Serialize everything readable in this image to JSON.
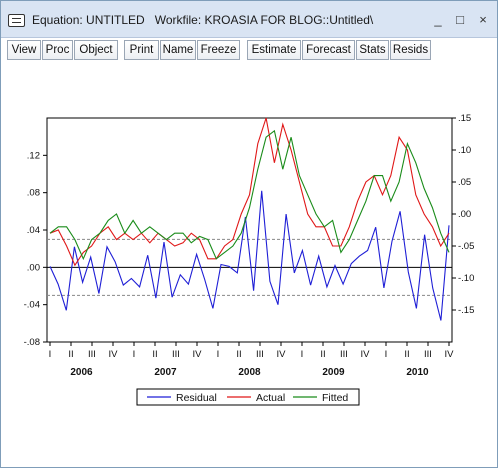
{
  "window": {
    "title": "Equation: UNTITLED   Workfile: KROASIA FOR BLOG::Untitled\\",
    "controls": {
      "minimize": "_",
      "maximize": "□",
      "close": "×"
    }
  },
  "toolbar": {
    "buttons": [
      "View",
      "Proc",
      "Object",
      "Print",
      "Name",
      "Freeze",
      "Estimate",
      "Forecast",
      "Stats",
      "Resids"
    ]
  },
  "chart_data": {
    "type": "line",
    "x": [
      "2006Q1",
      "2006Q2",
      "2006Q3",
      "2006Q4",
      "2007Q1",
      "2007Q2",
      "2007Q3",
      "2007Q4",
      "2008Q1",
      "2008Q2",
      "2008Q3",
      "2008Q4",
      "2009Q1",
      "2009Q2",
      "2009Q3",
      "2009Q4",
      "2010Q1",
      "2010Q2",
      "2010Q3",
      "2010Q4"
    ],
    "x_tick_labels": [
      "I",
      "II",
      "III",
      "IV",
      "I",
      "II",
      "III",
      "IV",
      "I",
      "II",
      "III",
      "IV",
      "I",
      "II",
      "III",
      "IV",
      "I",
      "II",
      "III",
      "IV"
    ],
    "year_labels": [
      "2006",
      "2007",
      "2008",
      "2009",
      "2010"
    ],
    "left_axis": {
      "ticks": [
        ".12",
        ".08",
        ".04",
        ".00",
        "-.04",
        "-.08"
      ],
      "ylim": [
        -0.08,
        0.16
      ]
    },
    "right_axis": {
      "ticks": [
        ".15",
        ".10",
        ".05",
        ".00",
        "-.05",
        "-.10",
        "-.15"
      ],
      "ylim": [
        -0.2,
        0.15
      ]
    },
    "reference_lines_left": [
      0.0,
      0.03,
      -0.03
    ],
    "series": [
      {
        "name": "Residual",
        "axis": "left",
        "color": "#1f1fd6",
        "values": [
          0.001,
          -0.018,
          -0.046,
          0.022,
          -0.016,
          0.011,
          -0.028,
          0.022,
          0.006,
          -0.019,
          -0.012,
          -0.021,
          0.013,
          -0.033,
          0.027,
          -0.032,
          -0.008,
          -0.018,
          0.014,
          -0.013,
          -0.044,
          0.003,
          0.001,
          -0.006,
          0.054,
          -0.025,
          0.082,
          -0.015,
          -0.04,
          0.057,
          -0.006,
          0.018,
          -0.019,
          0.012,
          -0.021,
          0.002,
          -0.018,
          0.004,
          0.012,
          0.018,
          0.043,
          -0.022,
          0.028,
          0.06,
          -0.005,
          -0.044,
          0.035,
          -0.022,
          -0.057,
          0.045
        ]
      },
      {
        "name": "Actual",
        "axis": "right",
        "color": "#e01818",
        "values": [
          -0.03,
          -0.025,
          -0.05,
          -0.08,
          -0.06,
          -0.05,
          -0.03,
          -0.02,
          -0.04,
          -0.03,
          -0.04,
          -0.03,
          -0.045,
          -0.03,
          -0.04,
          -0.05,
          -0.045,
          -0.03,
          -0.04,
          -0.07,
          -0.07,
          -0.05,
          -0.04,
          0.0,
          0.03,
          0.11,
          0.15,
          0.08,
          0.14,
          0.1,
          0.05,
          0.0,
          -0.02,
          -0.02,
          -0.05,
          -0.05,
          -0.02,
          0.02,
          0.05,
          0.06,
          0.03,
          0.06,
          0.12,
          0.1,
          0.03,
          0.0,
          -0.02,
          -0.05,
          -0.03
        ]
      },
      {
        "name": "Fitted",
        "axis": "right",
        "color": "#1a8c1a",
        "values": [
          -0.03,
          -0.02,
          -0.02,
          -0.04,
          -0.07,
          -0.04,
          -0.03,
          -0.01,
          0.0,
          -0.03,
          -0.01,
          -0.03,
          -0.02,
          -0.03,
          -0.04,
          -0.03,
          -0.03,
          -0.045,
          -0.035,
          -0.04,
          -0.07,
          -0.06,
          -0.05,
          -0.03,
          0.01,
          0.07,
          0.12,
          0.13,
          0.07,
          0.12,
          0.06,
          0.03,
          0.0,
          -0.02,
          -0.01,
          -0.06,
          -0.04,
          -0.01,
          0.02,
          0.06,
          0.06,
          0.02,
          0.05,
          0.11,
          0.08,
          0.04,
          0.01,
          -0.03,
          -0.06
        ]
      }
    ],
    "legend": [
      "Residual",
      "Actual",
      "Fitted"
    ],
    "legend_position": "bottom"
  }
}
